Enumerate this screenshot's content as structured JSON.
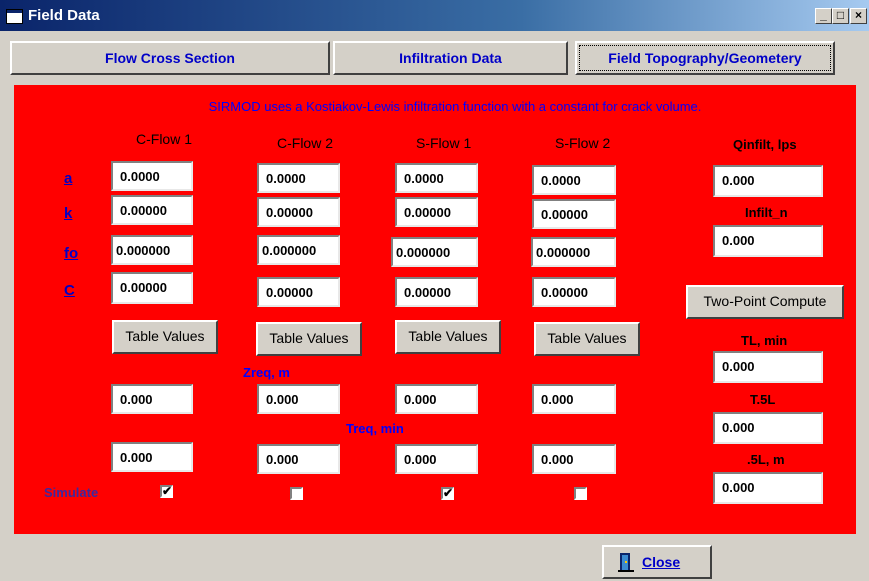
{
  "window": {
    "title": "Field Data",
    "minimize": "_",
    "maximize": "□",
    "close": "×"
  },
  "tabs": [
    "Flow Cross Section",
    "Infiltration Data",
    "Field Topography/Geometery"
  ],
  "note": "SIRMOD uses a Kostiakov-Lewis infiltration function with a constant for crack volume.",
  "columns": [
    "C-Flow 1",
    "C-Flow 2",
    "S-Flow 1",
    "S-Flow 2"
  ],
  "params": [
    "a",
    "k",
    "fo",
    "C"
  ],
  "values": {
    "a": [
      "0.0000",
      "0.0000",
      "0.0000",
      "0.0000"
    ],
    "k": [
      "0.00000",
      "0.00000",
      "0.00000",
      "0.00000"
    ],
    "fo": [
      "0.000000",
      "0.000000",
      "0.000000",
      "0.000000"
    ],
    "C": [
      "0.00000",
      "0.00000",
      "0.00000",
      "0.00000"
    ]
  },
  "table_values_label": "Table Values",
  "zreq": {
    "label": "Zreq, m",
    "values": [
      "0.000",
      "0.000",
      "0.000",
      "0.000"
    ]
  },
  "treq": {
    "label": "Treq, min",
    "values": [
      "0.000",
      "0.000",
      "0.000",
      "0.000"
    ]
  },
  "simulate": {
    "label": "Simulate",
    "checked": [
      true,
      false,
      true,
      false
    ],
    "check_mark": "✔"
  },
  "right": {
    "qinfilt_label": "Qinfilt, lps",
    "qinfilt_value": "0.000",
    "infilt_n_label": "Infilt_n",
    "infilt_n_value": "0.000",
    "two_point_label": "Two-Point Compute",
    "tl_label": "TL, min",
    "tl_value": "0.000",
    "t5l_label": "T.5L",
    "t5l_value": "0.000",
    "l5_label": ".5L, m",
    "l5_value": "0.000"
  },
  "close_label": "Close",
  "colors": {
    "panel": "#ff0000",
    "title_bar": "#0a246a",
    "link_blue": "#0000c8"
  }
}
